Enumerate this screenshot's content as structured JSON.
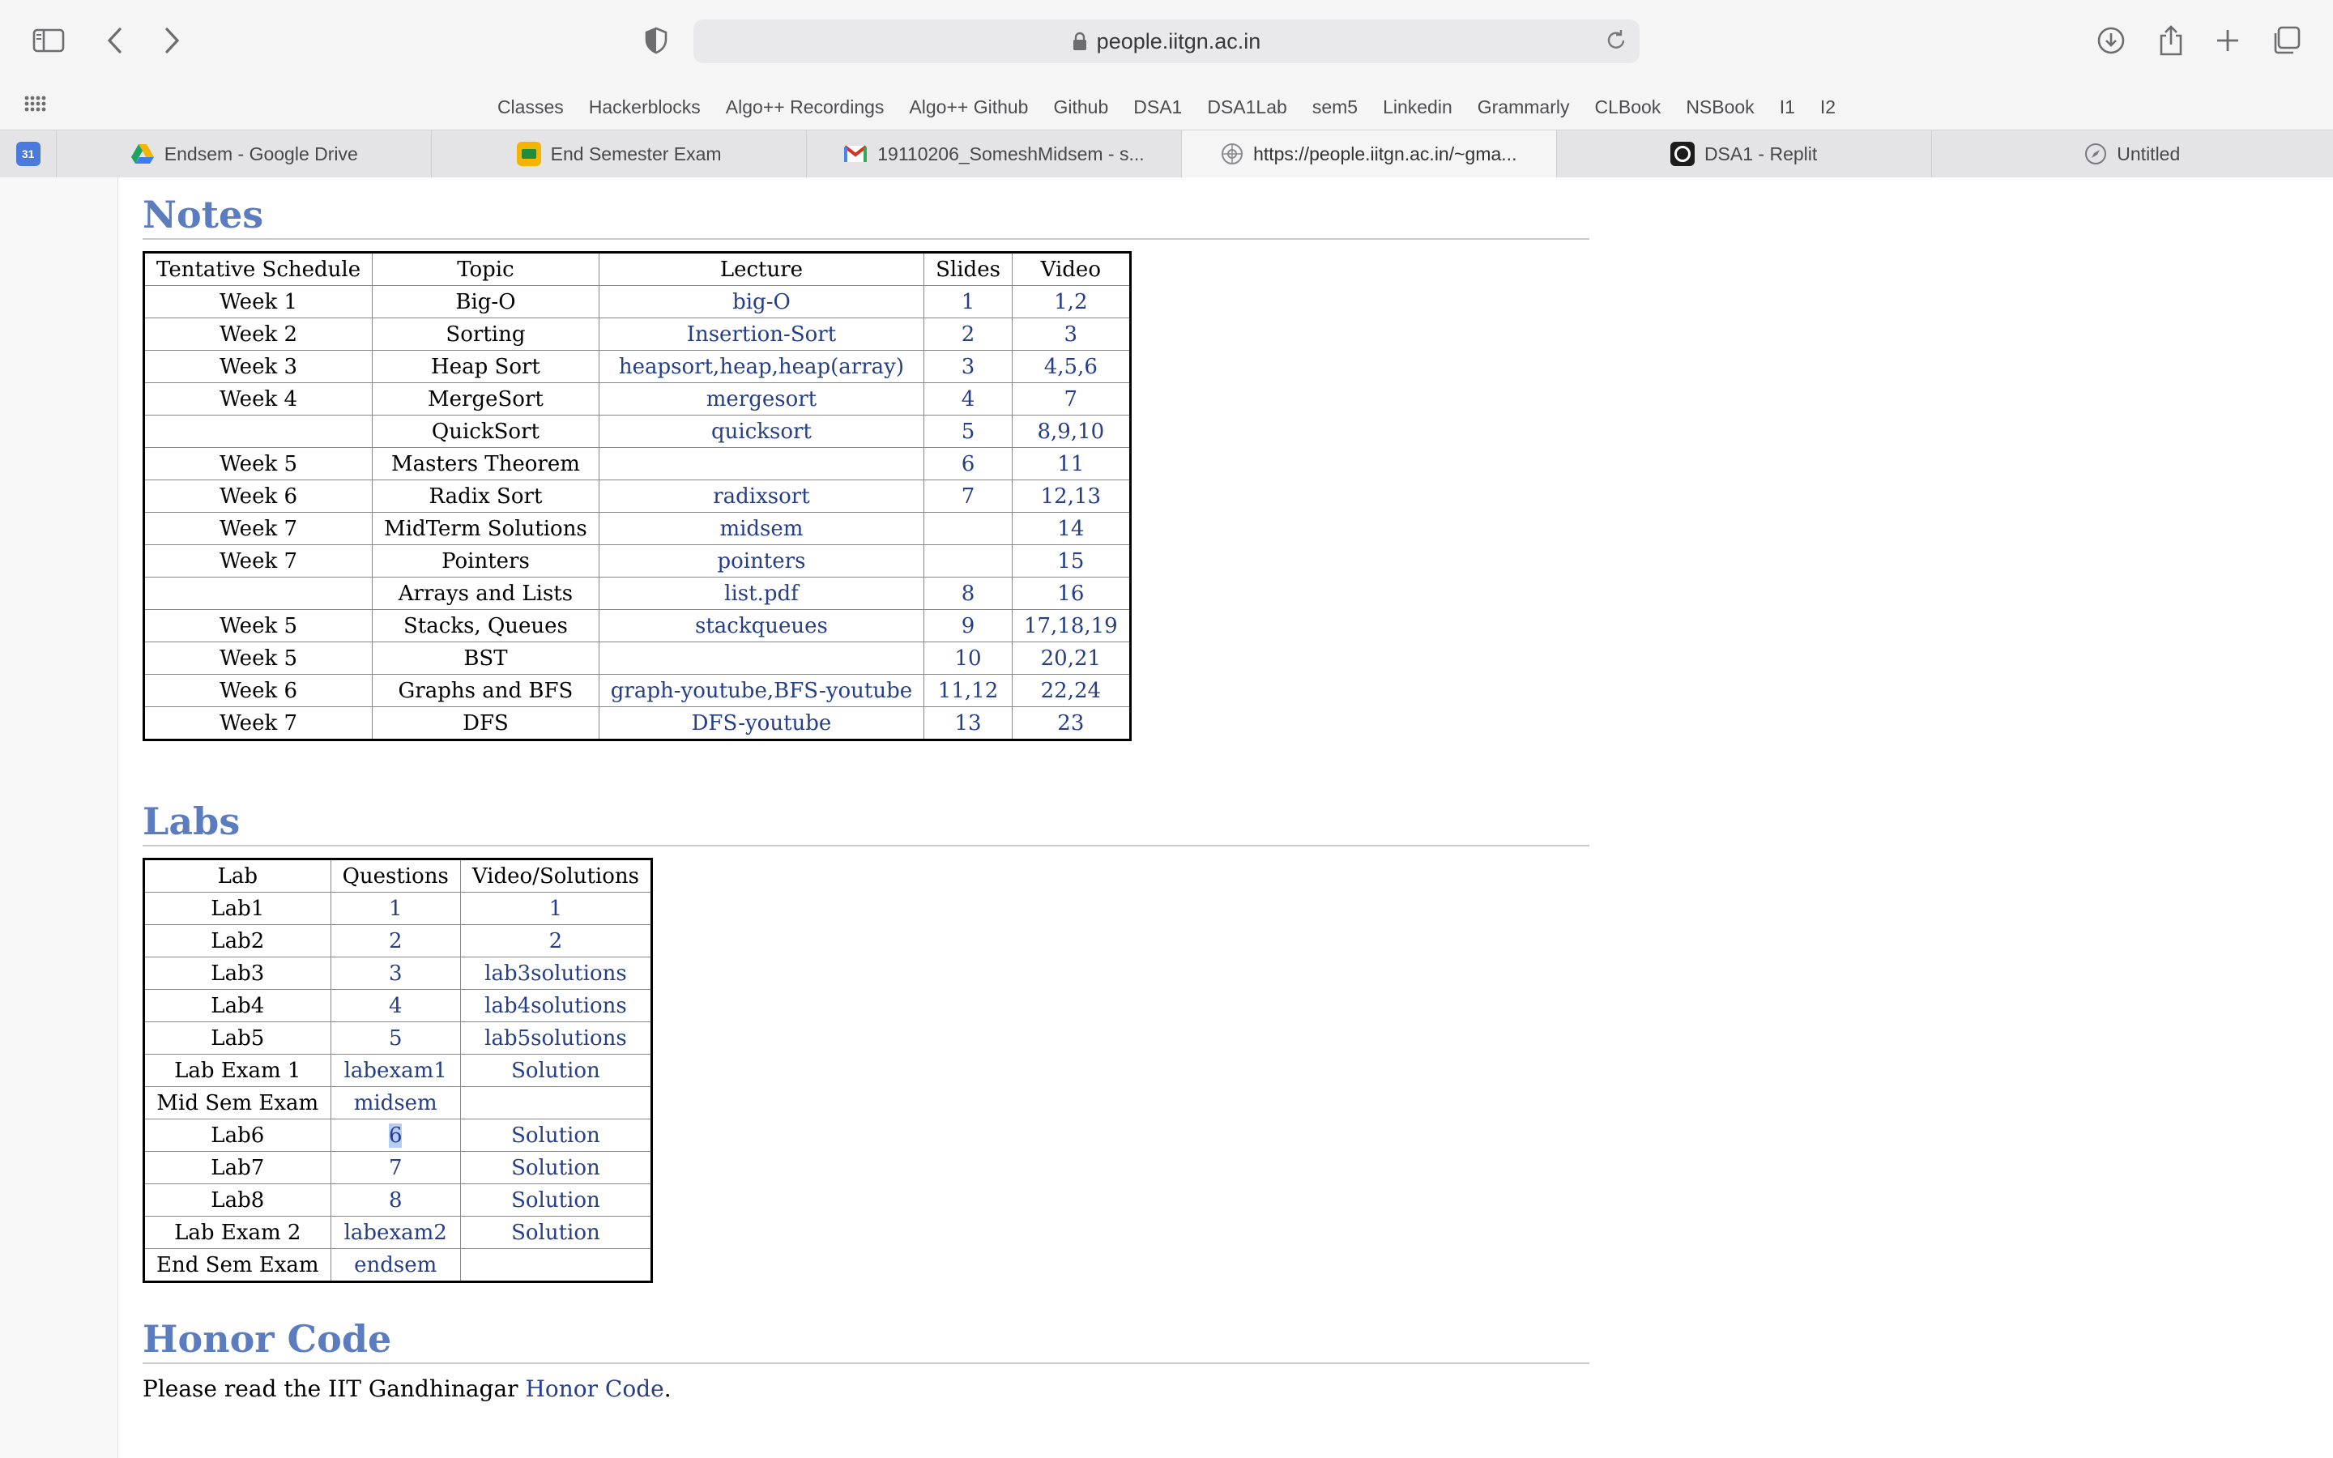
{
  "browser": {
    "address": "people.iitgn.ac.in",
    "favorites": [
      "Classes",
      "Hackerblocks",
      "Algo++ Recordings",
      "Algo++ Github",
      "Github",
      "DSA1",
      "DSA1Lab",
      "sem5",
      "Linkedin",
      "Grammarly",
      "CLBook",
      "NSBook",
      "I1",
      "I2"
    ],
    "pinned_tab_icon": "calendar-icon",
    "tabs": [
      {
        "label": "Endsem - Google Drive",
        "icon": "google-drive-icon"
      },
      {
        "label": "End Semester Exam",
        "icon": "classroom-icon"
      },
      {
        "label": "19110206_SomeshMidsem - s...",
        "icon": "gmail-icon"
      },
      {
        "label": "https://people.iitgn.ac.in/~gma...",
        "icon": "globe-icon",
        "active": true
      },
      {
        "label": "DSA1 - Replit",
        "icon": "replit-icon"
      },
      {
        "label": "Untitled",
        "icon": "compass-icon"
      }
    ]
  },
  "notes": {
    "heading": "Notes",
    "headers": [
      "Tentative Schedule",
      "Topic",
      "Lecture",
      "Slides",
      "Video"
    ],
    "rows": [
      [
        "Week 1",
        "Big-O",
        "big-O",
        "1",
        "1,2"
      ],
      [
        "Week 2",
        "Sorting",
        "Insertion-Sort",
        "2",
        "3"
      ],
      [
        "Week 3",
        "Heap Sort",
        "heapsort,heap,heap(array)",
        "3",
        "4,5,6"
      ],
      [
        "Week 4",
        "MergeSort",
        "mergesort",
        "4",
        "7"
      ],
      [
        "",
        "QuickSort",
        "quicksort",
        "5",
        "8,9,10"
      ],
      [
        "Week 5",
        "Masters Theorem",
        "",
        "6",
        "11"
      ],
      [
        "Week 6",
        "Radix Sort",
        "radixsort",
        "7",
        "12,13"
      ],
      [
        "Week 7",
        "MidTerm Solutions",
        "midsem",
        "",
        "14"
      ],
      [
        "Week 7",
        "Pointers",
        "pointers",
        "",
        "15"
      ],
      [
        "",
        "Arrays and Lists",
        "list.pdf",
        "8",
        "16"
      ],
      [
        "Week 5",
        "Stacks, Queues",
        "stackqueues",
        "9",
        "17,18,19"
      ],
      [
        "Week 5",
        "BST",
        "",
        "10",
        "20,21"
      ],
      [
        "Week 6",
        "Graphs and BFS",
        "graph-youtube,BFS-youtube",
        "11,12",
        "22,24"
      ],
      [
        "Week 7",
        "DFS",
        "DFS-youtube",
        "13",
        "23"
      ]
    ]
  },
  "labs": {
    "heading": "Labs",
    "headers": [
      "Lab",
      "Questions",
      "Video/Solutions"
    ],
    "rows": [
      [
        "Lab1",
        "1",
        "1"
      ],
      [
        "Lab2",
        "2",
        "2"
      ],
      [
        "Lab3",
        "3",
        "lab3solutions"
      ],
      [
        "Lab4",
        "4",
        "lab4solutions"
      ],
      [
        "Lab5",
        "5",
        "lab5solutions"
      ],
      [
        "Lab Exam 1",
        "labexam1",
        "Solution"
      ],
      [
        "Mid Sem Exam",
        "midsem",
        ""
      ],
      [
        "Lab6",
        "6",
        "Solution"
      ],
      [
        "Lab7",
        "7",
        "Solution"
      ],
      [
        "Lab8",
        "8",
        "Solution"
      ],
      [
        "Lab Exam 2",
        "labexam2",
        "Solution"
      ],
      [
        "End Sem Exam",
        "endsem",
        ""
      ]
    ]
  },
  "honor": {
    "heading": "Honor Code",
    "text": "Please read the IIT Gandhinagar ",
    "link": "Honor Code",
    "end": "."
  },
  "colors": {
    "heading": "#5b7cbf",
    "link": "#253e85",
    "selection": "#b5cdf2"
  }
}
